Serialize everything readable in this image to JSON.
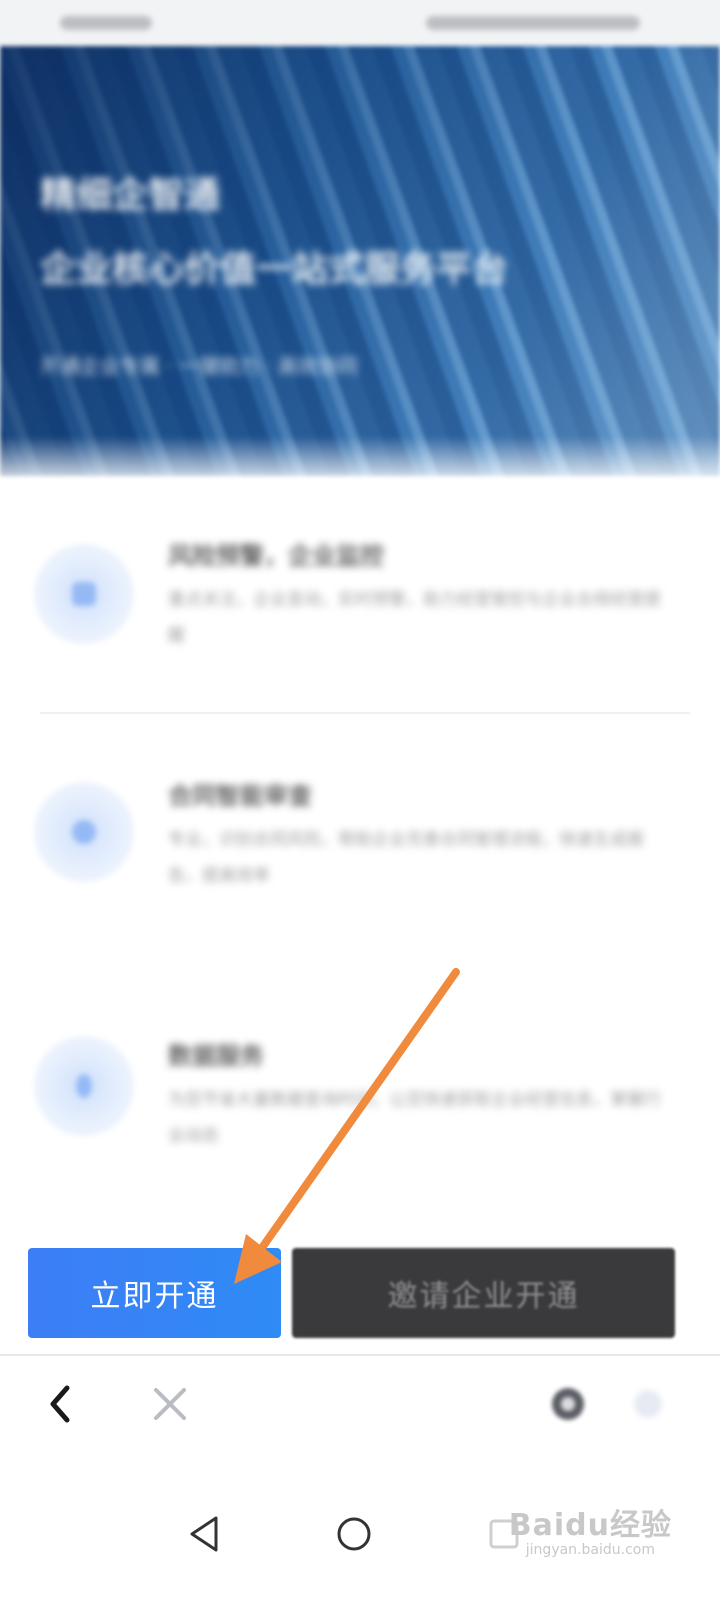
{
  "hero": {
    "title_line1": "精细企智通",
    "title_line2": "企业核心价值一站式服务平台",
    "tagline": "开通企业专属 · 一键助力 · 高效协同"
  },
  "features": [
    {
      "icon": "report-icon",
      "title": "风险预警，企业监控",
      "desc": "重点关注，企业变动，实时预警，助力经营管控与企业合规经营提醒"
    },
    {
      "icon": "shield-icon",
      "title": "合同智能审查",
      "desc": "专业，识别合同风险，帮助企业完善合同管理流程，快速生成报告，提高效率"
    },
    {
      "icon": "info-icon",
      "title": "数据服务",
      "desc": "为您节省大量数据查询时间，让您快速获取企业经营信息，掌握行业动态"
    }
  ],
  "actions": {
    "primary_label": "立即开通",
    "secondary_label": "邀请企业开通"
  },
  "toolbar": {
    "back_icon": "chevron-left-icon",
    "close_icon": "close-icon",
    "share_icon": "share-icon"
  },
  "navigation": {
    "back_icon": "triangle-back-icon",
    "home_icon": "circle-home-icon",
    "recents_icon": "square-recents-icon"
  },
  "watermark": {
    "brand": "Baidu经验",
    "url": "jingyan.baidu.com"
  },
  "colors": {
    "primary_button": "#3d7df6",
    "secondary_button": "#3a3a3c",
    "arrow": "#f08a3c"
  }
}
